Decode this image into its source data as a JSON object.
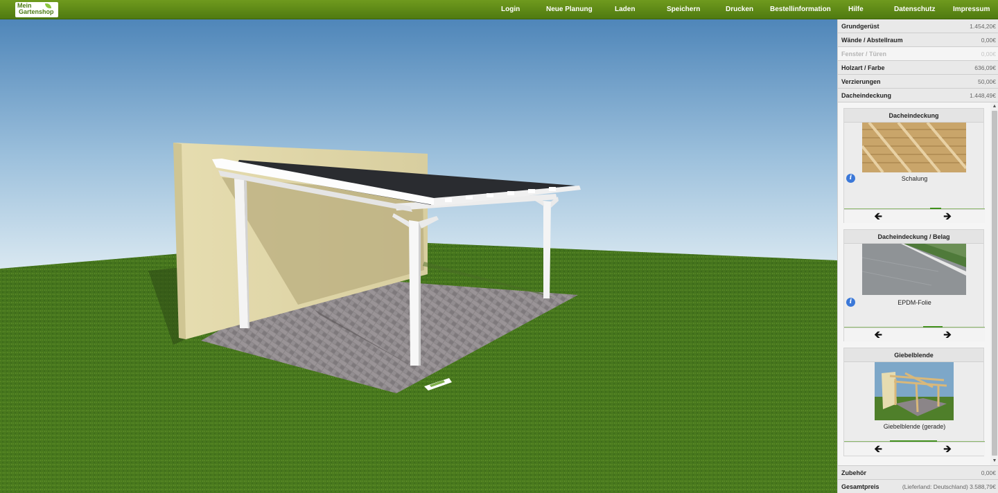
{
  "brand": {
    "line1": "Mein",
    "line2": "Gartenshop"
  },
  "nav": [
    "Login",
    "Neue Planung",
    "Laden",
    "Speichern",
    "Drucken",
    "Bestellinformation",
    "Hilfe",
    "Datenschutz",
    "Impressum"
  ],
  "categories": [
    {
      "label": "Grundgerüst",
      "price": "1.454,20€"
    },
    {
      "label": "Wände / Abstellraum",
      "price": "0,00€"
    },
    {
      "label": "Fenster / Türen",
      "price": "0,00€"
    },
    {
      "label": "Holzart / Farbe",
      "price": "636,09€"
    },
    {
      "label": "Verzierungen",
      "price": "50,00€"
    },
    {
      "label": "Dacheindeckung",
      "price": "1.448,49€"
    }
  ],
  "cards": [
    {
      "title": "Dacheindeckung",
      "caption": "Schalung",
      "image": "wood-planks"
    },
    {
      "title": "Dacheindeckung / Belag",
      "caption": "EPDM-Folie",
      "image": "epdm-roof"
    },
    {
      "title": "Giebelblende",
      "caption": "Giebelblende (gerade)",
      "image": "gable-frame"
    }
  ],
  "footer": {
    "accessories_label": "Zubehör",
    "accessories_price": "0,00€",
    "total_label": "Gesamtpreis",
    "total_value": "(Lieferland: Deutschland) 3.588,79€"
  },
  "colors": {
    "topbar": "#5f8a18",
    "info": "#3b78d8",
    "progress": "#3f8f1a"
  }
}
